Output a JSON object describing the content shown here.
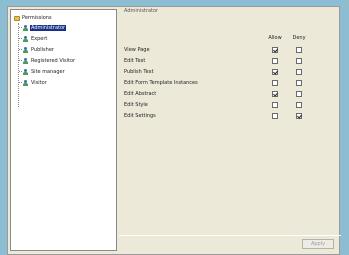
{
  "tree": {
    "root_label": "Permissions",
    "items": [
      {
        "label": "Administrator",
        "selected": true
      },
      {
        "label": "Expert",
        "selected": false
      },
      {
        "label": "Publisher",
        "selected": false
      },
      {
        "label": "Registered Visitor",
        "selected": false
      },
      {
        "label": "Site manager",
        "selected": false
      },
      {
        "label": "Visitor",
        "selected": false
      }
    ]
  },
  "panel": {
    "header": "Administrator",
    "columns": {
      "allow": "Allow",
      "deny": "Deny"
    },
    "permissions": [
      {
        "label": "View Page",
        "allow": true,
        "deny": false
      },
      {
        "label": "Edit Text",
        "allow": false,
        "deny": false
      },
      {
        "label": "Publish Text",
        "allow": true,
        "deny": false
      },
      {
        "label": "Edit Form Template Instances",
        "allow": false,
        "deny": false
      },
      {
        "label": "Edit Abstract",
        "allow": true,
        "deny": false
      },
      {
        "label": "Edit Style",
        "allow": false,
        "deny": false
      },
      {
        "label": "Edit Settings",
        "allow": false,
        "deny": true
      }
    ],
    "apply_label": "Apply"
  }
}
